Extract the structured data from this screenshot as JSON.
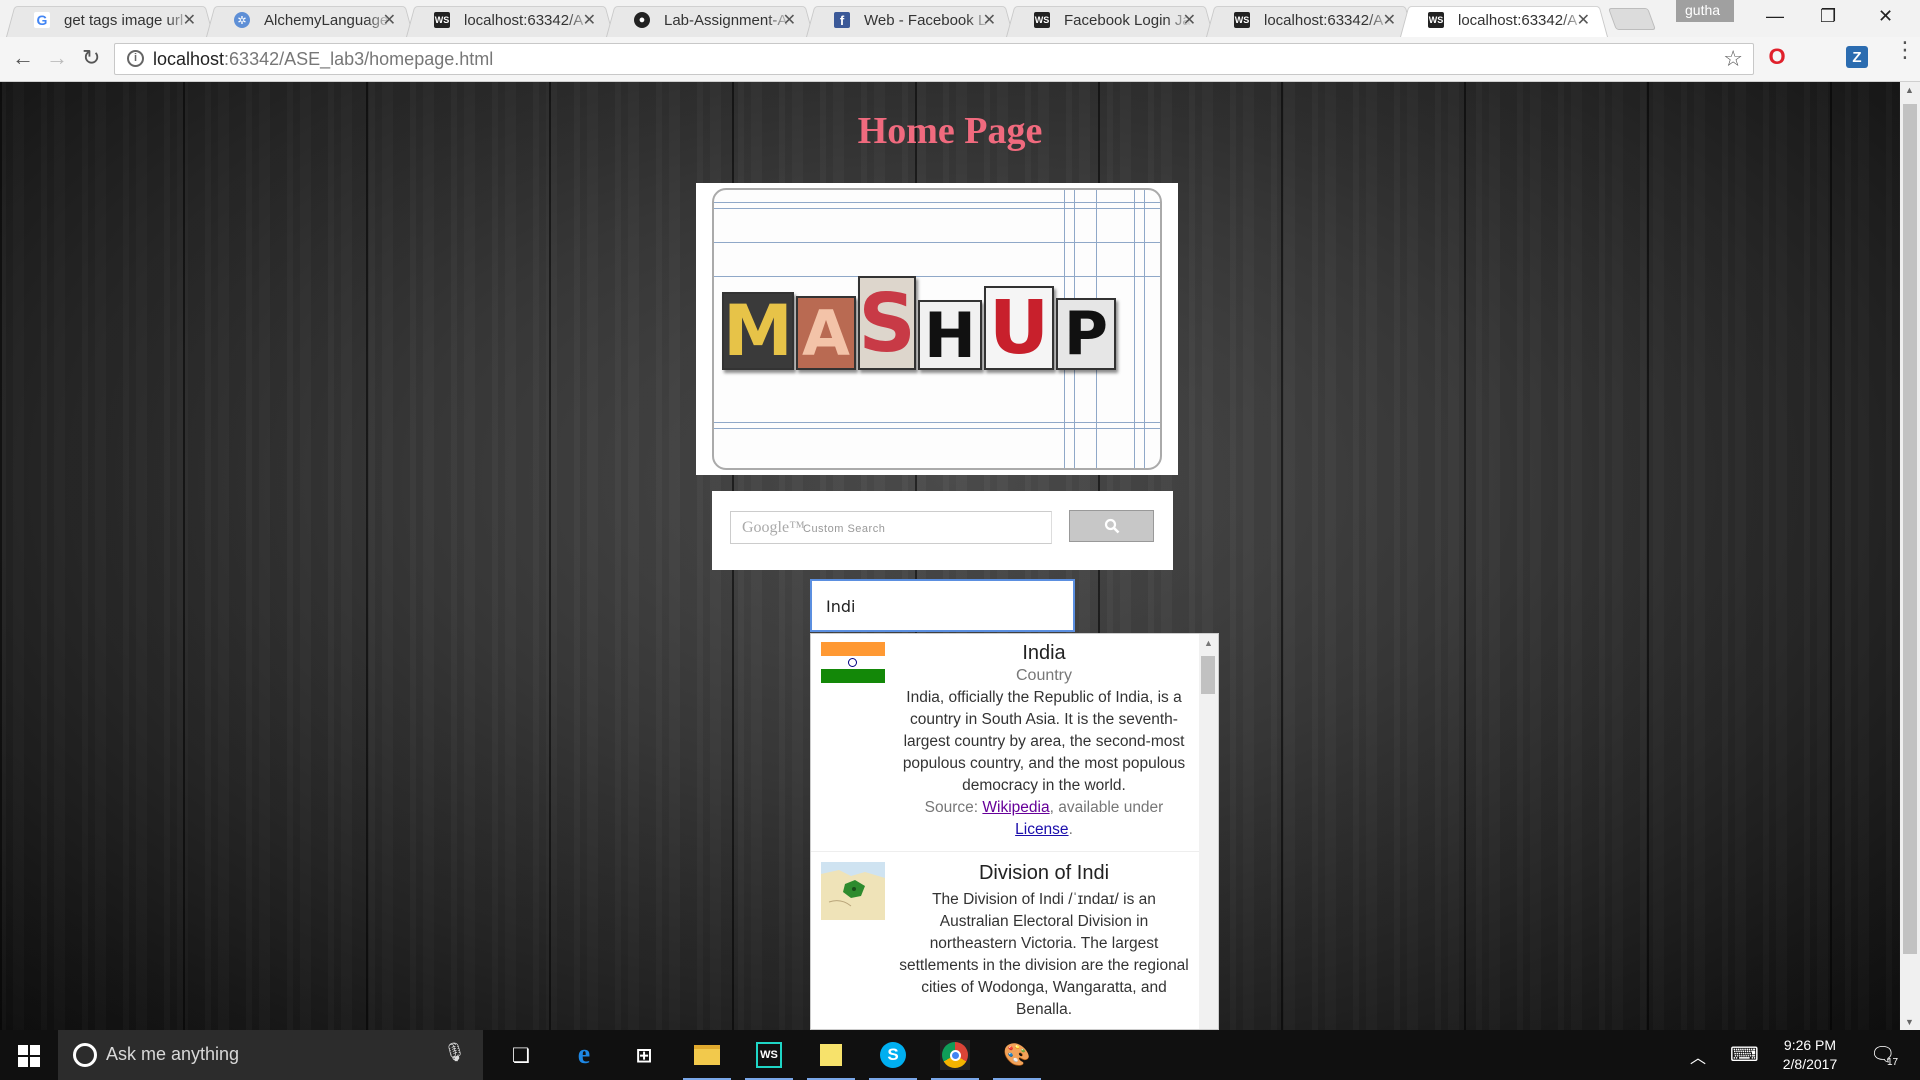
{
  "browser": {
    "tabs": [
      {
        "title": "get tags image url",
        "favicon": "google-icon"
      },
      {
        "title": "AlchemyLanguage",
        "favicon": "alchemy-icon"
      },
      {
        "title": "localhost:63342/A",
        "favicon": "webstorm-icon"
      },
      {
        "title": "Lab-Assignment-A",
        "favicon": "github-icon"
      },
      {
        "title": "Web - Facebook L",
        "favicon": "facebook-icon"
      },
      {
        "title": "Facebook Login Ja",
        "favicon": "webstorm-icon"
      },
      {
        "title": "localhost:63342/A",
        "favicon": "webstorm-icon"
      },
      {
        "title": "localhost:63342/A",
        "favicon": "webstorm-icon"
      }
    ],
    "active_tab_index": 7,
    "profile_name": "gutha",
    "url_host": "localhost",
    "url_rest": ":63342/ASE_lab3/homepage.html",
    "extensions": [
      "opera-icon",
      "zotero-icon"
    ]
  },
  "page": {
    "title": "Home Page",
    "logo": {
      "letters": [
        "M",
        "A",
        "S",
        "H",
        "U",
        "P"
      ]
    },
    "search": {
      "google_brand": "Google™",
      "placeholder": "Custom Search",
      "button_icon": "search-icon"
    },
    "entity_input_value": "Indi",
    "suggestions": [
      {
        "name": "India",
        "category": "Country",
        "description": "India, officially the Republic of India, is a country in South Asia. It is the seventh-largest country by area, the second-most populous country, and the most populous democracy in the world.",
        "source_prefix": "Source: ",
        "source_link": "Wikipedia",
        "source_mid": ", available under",
        "license_link": "License",
        "license_suffix": ".",
        "thumbnail": "india-flag-icon"
      },
      {
        "name": "Division of Indi",
        "category": "",
        "description": "The Division of Indi /ˈɪndaɪ/ is an Australian Electoral Division in northeastern Victoria. The largest settlements in the division are the regional cities of Wodonga, Wangaratta, and Benalla.",
        "thumbnail": "map-thumbnail"
      }
    ]
  },
  "taskbar": {
    "search_placeholder": "Ask me anything",
    "apps": [
      "task-view-icon",
      "edge-icon",
      "store-icon",
      "file-explorer-icon",
      "webstorm-icon",
      "sticky-notes-icon",
      "skype-icon",
      "chrome-icon",
      "paint-icon"
    ],
    "time": "9:26 PM",
    "date": "2/8/2017",
    "notification_count": "17"
  }
}
